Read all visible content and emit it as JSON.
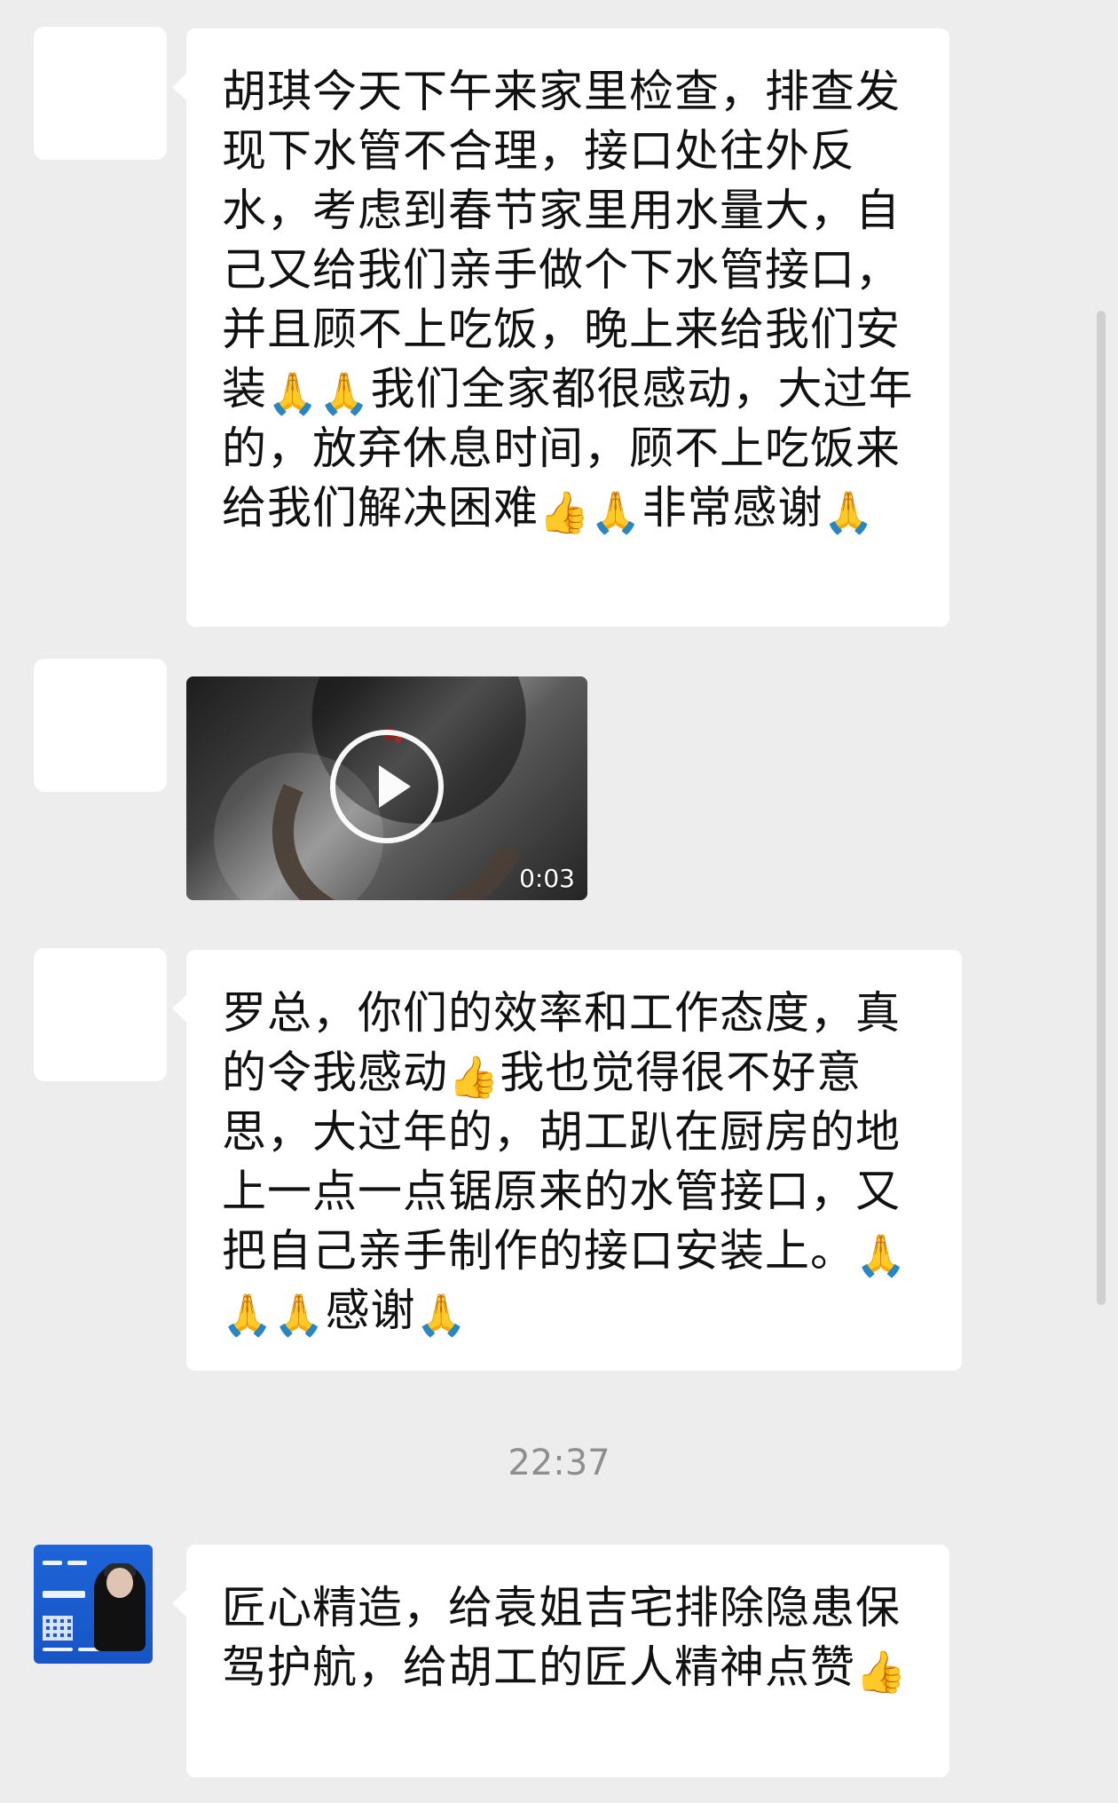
{
  "messages": [
    {
      "kind": "text",
      "text_parts": [
        "胡琪今天下午来家里检查，排查发现下水管不合理，接口处往外反水，考虑到春节家里用水量大，自己又给我们亲手做个下水管接口，并且顾不上吃饭，晚上来给我们安装",
        "🙏",
        "🙏",
        "我们全家都很感动，大过年的，放弃休息时间，顾不上吃饭来给我们解决困难",
        "👍",
        "🙏",
        "非常感谢",
        "🙏"
      ]
    },
    {
      "kind": "video",
      "duration": "0:03"
    },
    {
      "kind": "text",
      "text_parts": [
        "罗总，你们的效率和工作态度，真的令我感动",
        "👍",
        "我也觉得很不好意思，大过年的，胡工趴在厨房的地上一点一点锯原来的水管接口，又把自己亲手制作的接口安装上。",
        "🙏",
        "🙏",
        "🙏",
        "感谢",
        "🙏"
      ]
    }
  ],
  "timestamp": "22:37",
  "final_message": {
    "text_parts": [
      "匠心精造，给袁姐吉宅排除隐患保驾护航，给胡工的匠人精神点赞",
      "👍"
    ]
  },
  "icons": {
    "pray": "pray-icon",
    "thumbs_up": "thumbs-up-icon",
    "play": "play-icon"
  }
}
